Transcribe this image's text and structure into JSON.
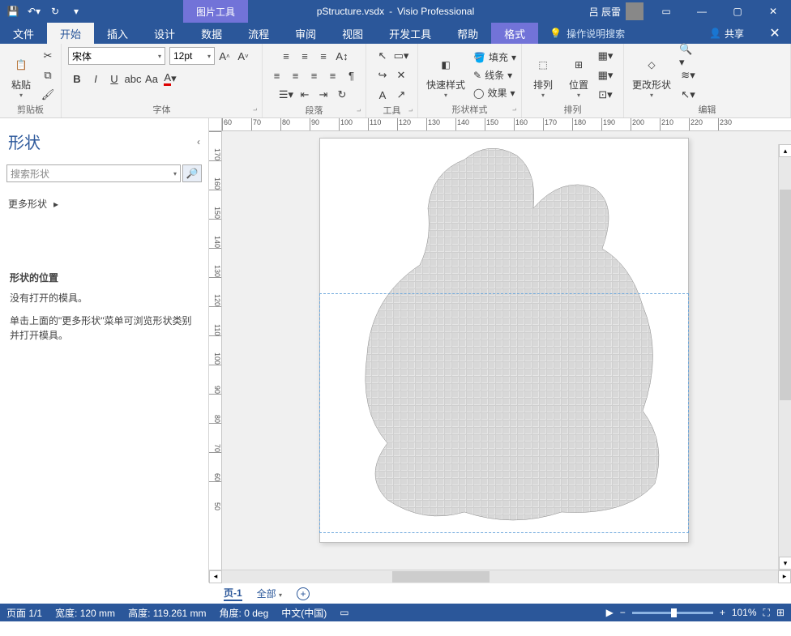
{
  "titlebar": {
    "filename": "pStructure.vsdx",
    "sep": "-",
    "app": "Visio Professional",
    "context_tool": "图片工具",
    "username": "吕 辰雷"
  },
  "tabs": {
    "file": "文件",
    "home": "开始",
    "insert": "插入",
    "design": "设计",
    "data": "数据",
    "process": "流程",
    "review": "审阅",
    "view": "视图",
    "developer": "开发工具",
    "help": "帮助",
    "format": "格式",
    "tellme": "操作说明搜索",
    "share": "共享"
  },
  "ribbon": {
    "clipboard": {
      "label": "剪贴板",
      "paste": "粘贴"
    },
    "font": {
      "label": "字体",
      "name": "宋体",
      "size": "12pt"
    },
    "paragraph": {
      "label": "段落"
    },
    "tools": {
      "label": "工具"
    },
    "shapestyles": {
      "label": "形状样式",
      "quick": "快速样式",
      "fill": "填充",
      "line": "线条",
      "effects": "效果"
    },
    "arrange": {
      "label": "排列",
      "arrange": "排列",
      "position": "位置"
    },
    "editing": {
      "label": "编辑",
      "change_shape": "更改形状"
    }
  },
  "shapes_pane": {
    "title": "形状",
    "search_placeholder": "搜索形状",
    "more": "更多形状",
    "section": "形状的位置",
    "no_stencil": "没有打开的模具。",
    "hint": "单击上面的\"更多形状\"菜单可浏览形状类别并打开模具。"
  },
  "ruler_h": [
    "60",
    "70",
    "80",
    "90",
    "100",
    "110",
    "120",
    "130",
    "140",
    "150",
    "160",
    "170",
    "180",
    "190",
    "200",
    "210",
    "220",
    "230"
  ],
  "ruler_v": [
    "170",
    "160",
    "150",
    "140",
    "130",
    "120",
    "110",
    "100",
    "90",
    "80",
    "70",
    "60",
    "50"
  ],
  "page_tabs": {
    "page1": "页-1",
    "all": "全部",
    "all_caret": "▾"
  },
  "status": {
    "pages": "页面 1/1",
    "width": "宽度: 120 mm",
    "height": "高度: 119.261 mm",
    "angle": "角度: 0 deg",
    "lang": "中文(中国)",
    "zoom_minus": "−",
    "zoom_plus": "+",
    "zoom": "101%"
  }
}
